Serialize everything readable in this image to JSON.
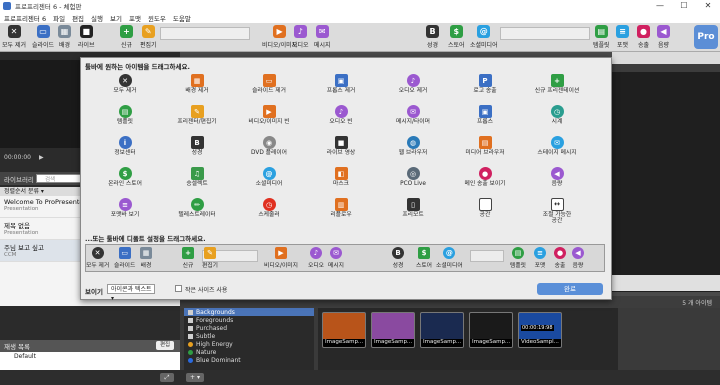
{
  "window": {
    "title": "프로프리젠터 6 - 체험판",
    "minimize": "—",
    "maximize": "☐",
    "close": "✕"
  },
  "menu": [
    "프로프리젠터 6",
    "파일",
    "편집",
    "실행",
    "보기",
    "포맷",
    "윈도우",
    "도움말"
  ],
  "toolbar": [
    {
      "label": "모두 제거",
      "icon": "clear-all-icon",
      "color": "#333333",
      "glyph": "✕"
    },
    {
      "label": "슬라이드",
      "icon": "slide-icon",
      "color": "#3b6fc4",
      "glyph": "▭"
    },
    {
      "label": "배경",
      "icon": "background-icon",
      "color": "#7a8a99",
      "glyph": "▦"
    },
    {
      "label": "라이브",
      "icon": "live-icon",
      "color": "#222222",
      "glyph": "■"
    },
    {
      "label": "신규",
      "icon": "new-icon",
      "color": "#2f9e44",
      "glyph": "+"
    },
    {
      "label": "편집기",
      "icon": "editor-icon",
      "color": "#e8a020",
      "glyph": "✎"
    },
    {
      "label": "비디오/이미지",
      "icon": "video-image-icon",
      "color": "#e07020",
      "glyph": "▶"
    },
    {
      "label": "오디오",
      "icon": "audio-icon",
      "color": "#9b59d0",
      "glyph": "♪"
    },
    {
      "label": "메시지",
      "icon": "message-icon",
      "color": "#9b59d0",
      "glyph": "✉"
    },
    {
      "label": "성경",
      "icon": "bible-icon",
      "color": "#333333",
      "glyph": "B"
    },
    {
      "label": "스토어",
      "icon": "store-icon",
      "color": "#2f9e44",
      "glyph": "$"
    },
    {
      "label": "소셜미디어",
      "icon": "social-media-icon",
      "color": "#2aa0e0",
      "glyph": "@"
    },
    {
      "label": "템플릿",
      "icon": "template-icon",
      "color": "#2f9e44",
      "glyph": "▤"
    },
    {
      "label": "포맷",
      "icon": "format-icon",
      "color": "#2aa0e0",
      "glyph": "≡"
    },
    {
      "label": "송출",
      "icon": "output-icon",
      "color": "#d02060",
      "glyph": "●"
    },
    {
      "label": "음량",
      "icon": "volume-icon",
      "color": "#9b59d0",
      "glyph": "◀"
    }
  ],
  "pro_badge": "Pro",
  "transport": {
    "time": "00:00:00",
    "play": "▶"
  },
  "library": {
    "header": "라이브러리",
    "search_placeholder": "검색",
    "column": "정렬순서 분류 ▾",
    "items": [
      {
        "title": "Welcome To ProPresenter 6",
        "sub": "Presentation"
      },
      {
        "title": "제목 없음",
        "sub": "Presentation"
      },
      {
        "title": "주님 보고 싶고",
        "sub": "CCM"
      }
    ]
  },
  "playlist": {
    "header": "재생 목록",
    "button": "편집",
    "item": "Default"
  },
  "dialog": {
    "title": "툴바에 원하는 아이템을 드래그하세요.",
    "items": [
      {
        "label": "모두 제거",
        "icon": "clear-all-icon",
        "color": "#333333",
        "glyph": "✕",
        "shape": "circle"
      },
      {
        "label": "배경 제거",
        "icon": "clear-background-icon",
        "color": "#e07020",
        "glyph": "▦",
        "shape": "square"
      },
      {
        "label": "슬라이드 제거",
        "icon": "clear-slide-icon",
        "color": "#e07020",
        "glyph": "▭",
        "shape": "square"
      },
      {
        "label": "프롭스 제거",
        "icon": "clear-props-icon",
        "color": "#3b6fc4",
        "glyph": "▣",
        "shape": "square"
      },
      {
        "label": "오디오 제거",
        "icon": "clear-audio-icon",
        "color": "#9b59d0",
        "glyph": "♪",
        "shape": "circle"
      },
      {
        "label": "로고 송출",
        "icon": "logo-icon",
        "color": "#3b6fc4",
        "glyph": "P",
        "shape": "square"
      },
      {
        "label": "신규 프리젠테이션",
        "icon": "new-presentation-icon",
        "color": "#2f9e44",
        "glyph": "+",
        "shape": "square"
      },
      {
        "label": "템플릿",
        "icon": "template-icon",
        "color": "#2f9e44",
        "glyph": "▤",
        "shape": "circle"
      },
      {
        "label": "프리젠터/편집기",
        "icon": "presenter-editor-icon",
        "color": "#e8a020",
        "glyph": "✎",
        "shape": "square"
      },
      {
        "label": "비디오/이미지 빈",
        "icon": "video-image-bin-icon",
        "color": "#e07020",
        "glyph": "▶",
        "shape": "square"
      },
      {
        "label": "오디오 빈",
        "icon": "audio-bin-icon",
        "color": "#9b59d0",
        "glyph": "♪",
        "shape": "circle"
      },
      {
        "label": "메시지/타이머",
        "icon": "message-timer-icon",
        "color": "#9b59d0",
        "glyph": "✉",
        "shape": "circle"
      },
      {
        "label": "프롭스",
        "icon": "props-icon",
        "color": "#3b6fc4",
        "glyph": "▣",
        "shape": "square"
      },
      {
        "label": "시계",
        "icon": "clock-icon",
        "color": "#2a9d8f",
        "glyph": "◷",
        "shape": "circle"
      },
      {
        "label": "정보센터",
        "icon": "info-center-icon",
        "color": "#3b6fc4",
        "glyph": "i",
        "shape": "circle"
      },
      {
        "label": "성경",
        "icon": "bible-icon",
        "color": "#333333",
        "glyph": "B",
        "shape": "square"
      },
      {
        "label": "DVD 플레이어",
        "icon": "dvd-player-icon",
        "color": "#888888",
        "glyph": "◉",
        "shape": "circle"
      },
      {
        "label": "라이브 영상",
        "icon": "live-video-icon",
        "color": "#333333",
        "glyph": "■",
        "shape": "square"
      },
      {
        "label": "웹 브라우저",
        "icon": "web-browser-icon",
        "color": "#2a7ab8",
        "glyph": "◍",
        "shape": "circle"
      },
      {
        "label": "미디어 브라우저",
        "icon": "media-browser-icon",
        "color": "#e07020",
        "glyph": "▤",
        "shape": "square"
      },
      {
        "label": "스테이지 메시지",
        "icon": "stage-message-icon",
        "color": "#2aa0e0",
        "glyph": "✉",
        "shape": "circle"
      },
      {
        "label": "온라인 스토어",
        "icon": "online-store-icon",
        "color": "#2f9e44",
        "glyph": "$",
        "shape": "circle"
      },
      {
        "label": "승셀렉트",
        "icon": "songselect-icon",
        "color": "#3a9a4a",
        "glyph": "♫",
        "shape": "square"
      },
      {
        "label": "소셜미디어",
        "icon": "social-media-icon",
        "color": "#2aa0e0",
        "glyph": "@",
        "shape": "circle"
      },
      {
        "label": "마스크",
        "icon": "mask-icon",
        "color": "#e07020",
        "glyph": "◧",
        "shape": "square"
      },
      {
        "label": "PCO Live",
        "icon": "pco-live-icon",
        "color": "#5a6a78",
        "glyph": "◎",
        "shape": "circle"
      },
      {
        "label": "메인 송출 보이기",
        "icon": "show-main-output-icon",
        "color": "#d02060",
        "glyph": "●",
        "shape": "circle"
      },
      {
        "label": "음량",
        "icon": "volume-icon",
        "color": "#9b59d0",
        "glyph": "◀",
        "shape": "circle"
      },
      {
        "label": "포맷바 보기",
        "icon": "format-bar-icon",
        "color": "#9b59d0",
        "glyph": "≡",
        "shape": "circle"
      },
      {
        "label": "텔레스트레이터",
        "icon": "telestrator-icon",
        "color": "#2f9e44",
        "glyph": "✏",
        "shape": "circle"
      },
      {
        "label": "스케줄러",
        "icon": "scheduler-icon",
        "color": "#e03020",
        "glyph": "◷",
        "shape": "circle"
      },
      {
        "label": "리플로우",
        "icon": "reflow-icon",
        "color": "#e07020",
        "glyph": "▥",
        "shape": "square"
      },
      {
        "label": "프리모트",
        "icon": "pre-remote-icon",
        "color": "#333333",
        "glyph": "▯",
        "shape": "square"
      },
      {
        "label": "공간",
        "icon": "space-icon",
        "color": "#ffffff",
        "glyph": "",
        "shape": "square"
      },
      {
        "label": "조절 가능한 공간",
        "icon": "flexible-space-icon",
        "color": "#ffffff",
        "glyph": "↔",
        "shape": "square"
      }
    ],
    "default_title": "...또는 툴바에 디폴트 설정을 드래그하세요.",
    "default_items": [
      {
        "label": "모두 제거",
        "icon": "clear-all-icon",
        "color": "#333333",
        "glyph": "✕"
      },
      {
        "label": "슬라이드",
        "icon": "slide-icon",
        "color": "#3b6fc4",
        "glyph": "▭"
      },
      {
        "label": "배경",
        "icon": "background-icon",
        "color": "#7a8a99",
        "glyph": "▦"
      },
      {
        "label": "신규",
        "icon": "new-icon",
        "color": "#2f9e44",
        "glyph": "+"
      },
      {
        "label": "편집기",
        "icon": "editor-icon",
        "color": "#e8a020",
        "glyph": "✎"
      },
      {
        "label": "비디오/이미지",
        "icon": "video-image-icon",
        "color": "#e07020",
        "glyph": "▶"
      },
      {
        "label": "오디오",
        "icon": "audio-icon",
        "color": "#9b59d0",
        "glyph": "♪"
      },
      {
        "label": "메시지",
        "icon": "message-icon",
        "color": "#9b59d0",
        "glyph": "✉"
      },
      {
        "label": "성경",
        "icon": "bible-icon",
        "color": "#333333",
        "glyph": "B"
      },
      {
        "label": "스토어",
        "icon": "store-icon",
        "color": "#2f9e44",
        "glyph": "$"
      },
      {
        "label": "소셜미디어",
        "icon": "social-media-icon",
        "color": "#2aa0e0",
        "glyph": "@"
      },
      {
        "label": "템플릿",
        "icon": "template-icon",
        "color": "#2f9e44",
        "glyph": "▤"
      },
      {
        "label": "포맷",
        "icon": "format-icon",
        "color": "#2aa0e0",
        "glyph": "≡"
      },
      {
        "label": "송출",
        "icon": "output-icon",
        "color": "#d02060",
        "glyph": "●"
      },
      {
        "label": "음량",
        "icon": "volume-icon",
        "color": "#9b59d0",
        "glyph": "◀"
      }
    ],
    "show_label": "보이기",
    "show_value": "아이콘과 텍스트 ▾",
    "small_size_label": "작은 사이즈 사용",
    "ok": "완료"
  },
  "media": {
    "count": "5 개 아이템",
    "categories": [
      {
        "label": "Backgrounds",
        "color": "#cfcfcf",
        "kind": "sq"
      },
      {
        "label": "Foregrounds",
        "color": "#cfcfcf",
        "kind": "sq"
      },
      {
        "label": "Purchased",
        "color": "#cfcfcf",
        "kind": "sq"
      },
      {
        "label": "Subtle",
        "color": "#cfcfcf",
        "kind": "sq"
      },
      {
        "label": "High Energy",
        "color": "#e8a020",
        "kind": "dot"
      },
      {
        "label": "Nature",
        "color": "#2f9e44",
        "kind": "dot"
      },
      {
        "label": "Blue Dominant",
        "color": "#2a6ae0",
        "kind": "dot"
      }
    ],
    "thumbs": [
      {
        "label": "ImageSamp...",
        "bg": "#b8541a"
      },
      {
        "label": "ImageSamp...",
        "bg": "#8a4aa0"
      },
      {
        "label": "ImageSamp...",
        "bg": "#1a2a50"
      },
      {
        "label": "ImageSamp...",
        "bg": "#1a1a1a"
      },
      {
        "label": "VideoSampl...",
        "bg": "#1a4aa0",
        "time": "00:00:19:98"
      }
    ]
  },
  "bottom": {
    "add": "+ ▾",
    "expand": "⤢"
  }
}
